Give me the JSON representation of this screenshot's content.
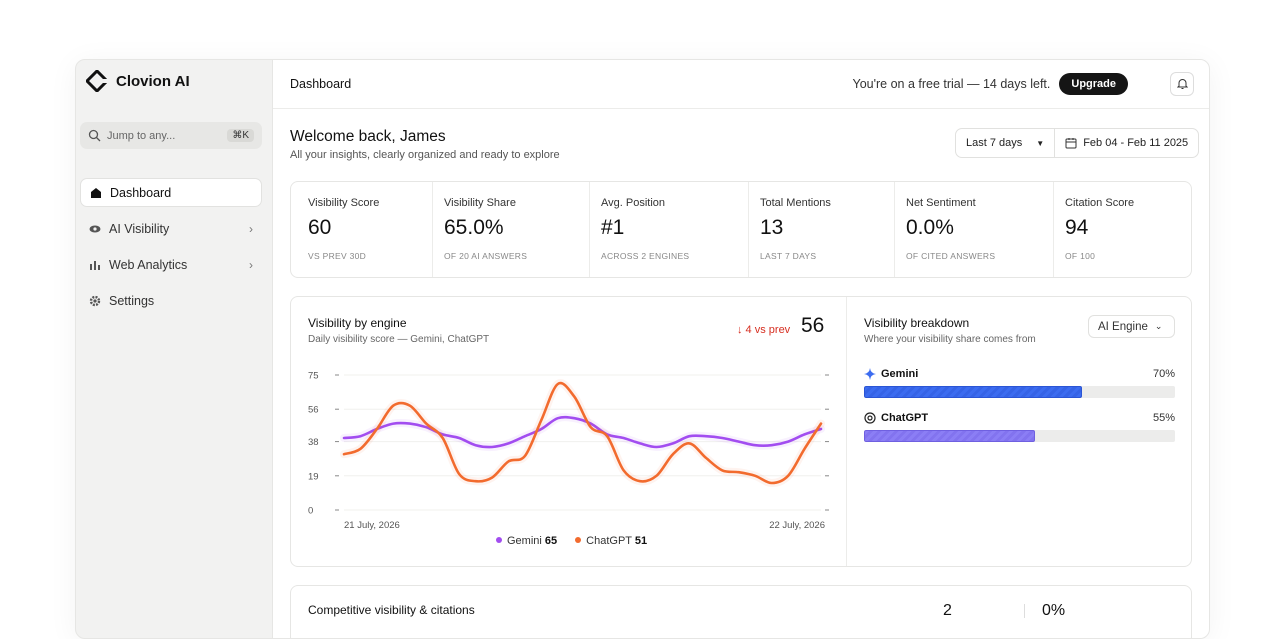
{
  "app": {
    "name": "Clovion AI"
  },
  "search": {
    "placeholder": "Jump to any...",
    "shortcut": "⌘K"
  },
  "sidebar": {
    "items": [
      {
        "label": "Dashboard",
        "icon": "home-icon",
        "active": true
      },
      {
        "label": "AI Visibility",
        "icon": "eye-icon"
      },
      {
        "label": "Web Analytics",
        "icon": "bar-chart-icon"
      },
      {
        "label": "Settings",
        "icon": "gear-icon"
      }
    ]
  },
  "header": {
    "title": "Dashboard",
    "trial_text": "You're on a free trial — 14 days left.",
    "upgrade_label": "Upgrade"
  },
  "welcome": {
    "title": "Welcome back, James",
    "subtitle": "All your insights, clearly organized and ready to explore"
  },
  "date_filter": {
    "range_label": "Last 7 days",
    "dates": "Feb 04 - Feb 11 2025"
  },
  "metrics": [
    {
      "label": "Visibility Score",
      "value": "60",
      "sub": "VS PREV 30D"
    },
    {
      "label": "Visibility Share",
      "value": "65.0%",
      "sub": "OF 20 AI ANSWERS"
    },
    {
      "label": "Avg. Position",
      "value": "#1",
      "sub": "ACROSS 2 ENGINES"
    },
    {
      "label": "Total Mentions",
      "value": "13",
      "sub": "LAST 7 DAYS"
    },
    {
      "label": "Net Sentiment",
      "value": "0.0%",
      "sub": "OF CITED ANSWERS"
    },
    {
      "label": "Citation Score",
      "value": "94",
      "sub": "OF 100"
    }
  ],
  "visibility_chart": {
    "title": "Visibility by engine",
    "subtitle": "Daily visibility score — Gemini, ChatGPT",
    "delta": "↓ 4 vs prev",
    "score": "56",
    "legend": [
      {
        "name": "Gemini",
        "value": "65",
        "color": "#a24df0"
      },
      {
        "name": "ChatGPT",
        "value": "51",
        "color": "#f26b2e"
      }
    ]
  },
  "chart_data": {
    "type": "line",
    "title": "Visibility by engine",
    "subtitle": "Daily visibility score — Gemini, ChatGPT",
    "x_tick_labels": [
      "21 July, 2026",
      "22 July, 2026"
    ],
    "yticks": [
      0,
      19,
      38,
      56,
      75
    ],
    "ylim": [
      0,
      75
    ],
    "grid": true,
    "legend_position": "bottom-center",
    "x": [
      0,
      1,
      2,
      3,
      4,
      5,
      6,
      7,
      8,
      9,
      10,
      11,
      12,
      13,
      14,
      15,
      16,
      17,
      18,
      19,
      20,
      21,
      22,
      23,
      24,
      25,
      26,
      27,
      28,
      29
    ],
    "series": [
      {
        "name": "Gemini",
        "color": "#a24df0",
        "values": [
          40,
          41,
          45,
          48,
          48,
          46,
          42,
          40,
          36,
          35,
          37,
          41,
          45,
          51,
          51,
          48,
          42,
          40,
          37,
          35,
          37,
          41,
          41,
          40,
          38,
          36,
          36,
          38,
          42,
          45
        ]
      },
      {
        "name": "ChatGPT",
        "color": "#f26b2e",
        "values": [
          31,
          34,
          45,
          58,
          58,
          48,
          40,
          20,
          16,
          18,
          27,
          30,
          50,
          70,
          63,
          46,
          41,
          22,
          16,
          19,
          31,
          37,
          29,
          22,
          21,
          19,
          15,
          19,
          34,
          48
        ]
      }
    ]
  },
  "breakdown": {
    "title": "Visibility breakdown",
    "subtitle": "Where your visibility share comes from",
    "select_label": "AI Engine",
    "rows": [
      {
        "name": "Gemini",
        "pct": "70%",
        "value": 0.7,
        "color": "#3c6cf0",
        "icon": "sparkle-icon"
      },
      {
        "name": "ChatGPT",
        "pct": "55%",
        "value": 0.55,
        "color": "#8b7ef5",
        "icon": "openai-icon"
      }
    ]
  },
  "competitive": {
    "title": "Competitive visibility & citations",
    "stat1": "2",
    "stat2": "0%"
  }
}
